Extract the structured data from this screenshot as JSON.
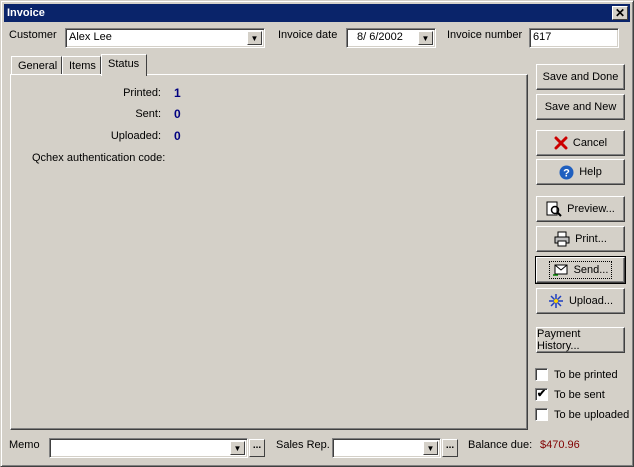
{
  "window": {
    "title": "Invoice",
    "close_glyph": "✕"
  },
  "header": {
    "customer_label": "Customer",
    "customer_value": "Alex Lee",
    "invoice_date_label": "Invoice date",
    "invoice_date_value": "8/ 6/2002",
    "invoice_number_label": "Invoice number",
    "invoice_number_value": "617"
  },
  "tabs": [
    {
      "label": "General",
      "active": false
    },
    {
      "label": "Items",
      "active": false
    },
    {
      "label": "Status",
      "active": true
    }
  ],
  "status": {
    "printed_label": "Printed:",
    "printed_value": "1",
    "sent_label": "Sent:",
    "sent_value": "0",
    "uploaded_label": "Uploaded:",
    "uploaded_value": "0",
    "qchex_label": "Qchex authentication code:"
  },
  "buttons": {
    "save_done": "Save and Done",
    "save_new": "Save and New",
    "cancel": "Cancel",
    "help": "Help",
    "preview": "Preview...",
    "print": "Print...",
    "send": "Send...",
    "upload": "Upload...",
    "payment_history": "Payment History..."
  },
  "checkboxes": [
    {
      "label": "To be printed",
      "checked": false
    },
    {
      "label": "To be sent",
      "checked": true
    },
    {
      "label": "To be uploaded",
      "checked": false
    }
  ],
  "footer": {
    "memo_label": "Memo",
    "memo_value": "",
    "sales_rep_label": "Sales Rep.",
    "sales_rep_value": "",
    "balance_label": "Balance due:",
    "balance_value": "$470.96",
    "ellipsis": "..."
  },
  "icons": {
    "cancel": "red-x-icon",
    "help": "question-circle-icon",
    "preview": "magnifier-document-icon",
    "print": "printer-icon",
    "send": "envelope-send-icon",
    "upload": "upload-sparkle-icon",
    "dropdown": "chevron-down-icon"
  },
  "colors": {
    "titlebar": "#0a246a",
    "window_bg": "#d4d0c8",
    "status_value": "#000080",
    "balance": "#800000",
    "cancel_icon": "#cc0000",
    "help_icon": "#1f5fbf"
  }
}
